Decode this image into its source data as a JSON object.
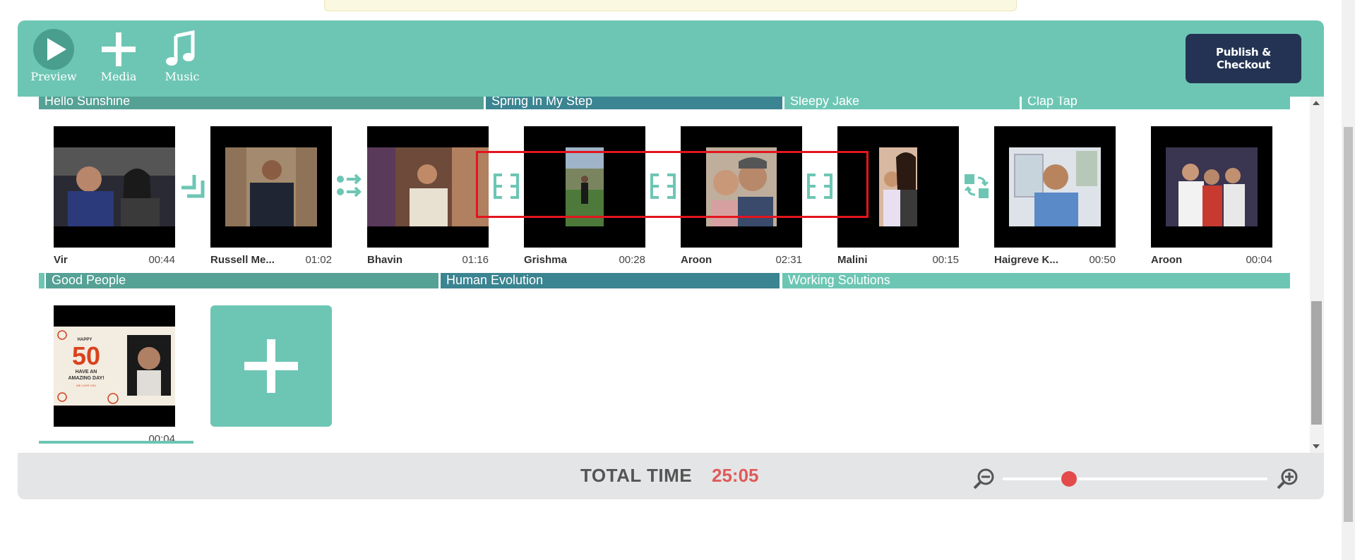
{
  "toolbar": {
    "preview_label": "Preview",
    "media_label": "Media",
    "music_label": "Music",
    "publish_label": "Publish & Checkout"
  },
  "music_tracks_row1": [
    "Hello Sunshine",
    "Spring In My Step",
    "Sleepy Jake",
    "Clap Tap"
  ],
  "music_tracks_row2": [
    "",
    "Good People",
    "Human Evolution",
    "Working Solutions"
  ],
  "clips": [
    {
      "name": "Vir",
      "duration": "00:44"
    },
    {
      "name": "Russell Me...",
      "duration": "01:02"
    },
    {
      "name": "Bhavin",
      "duration": "01:16"
    },
    {
      "name": "Grishma",
      "duration": "00:28"
    },
    {
      "name": "Aroon",
      "duration": "02:31"
    },
    {
      "name": "Malini",
      "duration": "00:15"
    },
    {
      "name": "Haigreve K...",
      "duration": "00:50"
    },
    {
      "name": "Aroon",
      "duration": "00:04"
    },
    {
      "name": "",
      "duration": "00:04"
    }
  ],
  "birthday_card": {
    "happy": "HAPPY",
    "number": "50",
    "line1": "HAVE AN",
    "line2": "AMAZING DAY!",
    "line3": "WE LOVE YOU"
  },
  "footer": {
    "total_label": "TOTAL TIME",
    "total_value": "25:05",
    "zoom_level": 0.25
  },
  "colors": {
    "teal": "#6dc6b4",
    "navy": "#243353",
    "accent_red": "#e05a5a"
  }
}
